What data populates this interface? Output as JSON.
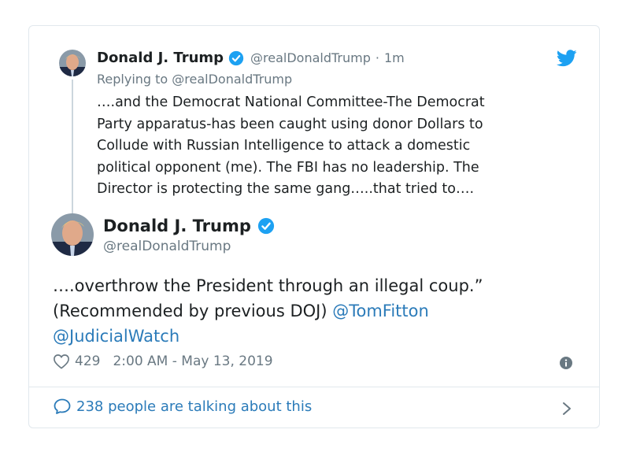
{
  "parent_tweet": {
    "author_name": "Donald J. Trump",
    "handle": "@realDonaldTrump",
    "separator": "·",
    "time_ago": "1m",
    "replying_to": "Replying to @realDonaldTrump",
    "text": "….and the Democrat National Committee-The Democrat\nParty apparatus-has been caught using donor Dollars to\nCollude with Russian Intelligence to attack a domestic\npolitical opponent (me). The FBI has no leadership. The\nDirector is protecting the same gang…..that tried to…."
  },
  "main_tweet": {
    "author_name": "Donald J. Trump",
    "handle": "@realDonaldTrump",
    "text_part1": "….overthrow the President through an illegal coup.” (Recommended by previous DOJ) ",
    "mention1": "@TomFitton",
    "mention2": "@JudicialWatch",
    "like_count": "429",
    "timestamp": "2:00 AM - May 13, 2019"
  },
  "footer": {
    "talking_text": "238 people are talking about this"
  },
  "colors": {
    "link": "#2b7bb9",
    "muted": "#697882",
    "border": "#e1e8ed",
    "verified": "#1da1f2",
    "twitter_brand": "#1da1f2"
  },
  "icons": {
    "verified": "verified-badge-icon",
    "brand": "twitter-bird-icon",
    "like": "heart-icon",
    "info": "info-icon",
    "conversation": "speech-bubble-icon",
    "navigate": "chevron-right-icon"
  }
}
